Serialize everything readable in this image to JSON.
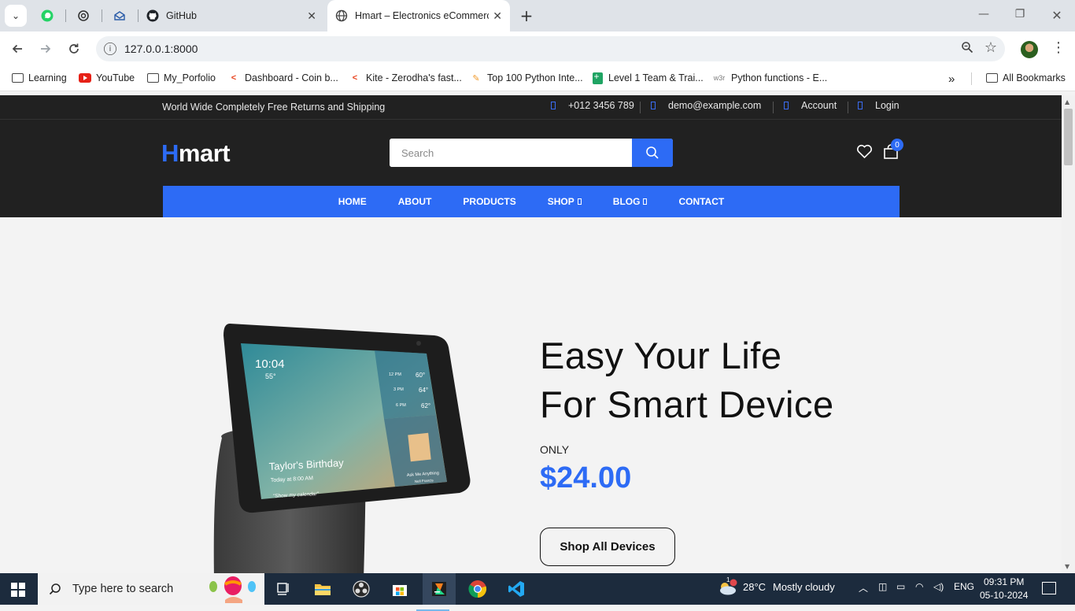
{
  "browser": {
    "tabs": [
      {
        "title": "",
        "icon": "whatsapp-icon"
      },
      {
        "title": "",
        "icon": "chatgpt-icon"
      },
      {
        "title": "",
        "icon": "mail-icon"
      },
      {
        "title": "GitHub",
        "icon": "github-icon"
      },
      {
        "title": "Hmart – Electronics eCommerce",
        "icon": "globe-icon",
        "active": true
      }
    ],
    "url": "127.0.0.1:8000",
    "bookmarks": [
      {
        "label": "Learning",
        "icon": "folder-icon"
      },
      {
        "label": "YouTube",
        "icon": "youtube-icon"
      },
      {
        "label": "My_Porfolio",
        "icon": "folder-icon"
      },
      {
        "label": "Dashboard - Coin b...",
        "icon": "zerodha-icon"
      },
      {
        "label": "Kite - Zerodha's fast...",
        "icon": "zerodha-icon"
      },
      {
        "label": "Top 100 Python Inte...",
        "icon": "pen-icon"
      },
      {
        "label": "Level 1 Team & Trai...",
        "icon": "sheets-icon"
      },
      {
        "label": "Python functions - E...",
        "icon": "w3schools-icon"
      }
    ],
    "all_bookmarks": "All Bookmarks",
    "overflow": "»"
  },
  "site": {
    "topbar": {
      "promo": "World Wide Completely Free Returns and Shipping",
      "phone": "+012 3456 789",
      "email": "demo@example.com",
      "account": "Account",
      "login": "Login"
    },
    "logo_h": "H",
    "logo_rest": "mart",
    "search": {
      "placeholder": "Search"
    },
    "cart_count": "0",
    "nav": [
      "HOME",
      "ABOUT",
      "PRODUCTS",
      "SHOP",
      "BLOG",
      "CONTACT"
    ],
    "hero": {
      "line1": "Easy Your Life",
      "line2": "For Smart Device",
      "only": "ONLY",
      "price": "$24.00",
      "cta": "Shop All Devices",
      "device_screen": {
        "time": "10:04",
        "temp": "55°",
        "event": "Taylor's Birthday",
        "event_time": "Today at 8:00 AM",
        "prompt": "\"Show my calendar\"",
        "forecast": [
          {
            "t": "12 PM",
            "v": "60°"
          },
          {
            "t": "3 PM",
            "v": "64°"
          },
          {
            "t": "6 PM",
            "v": "62°"
          }
        ],
        "card_title": "Ask Me Anything",
        "card_sub": "Nell Francis"
      }
    }
  },
  "taskbar": {
    "search_text": "Type here to search",
    "weather_temp": "28°C",
    "weather_desc": "Mostly cloudy",
    "weather_badge": "1",
    "lang": "ENG",
    "time": "09:31 PM",
    "date": "05-10-2024"
  }
}
